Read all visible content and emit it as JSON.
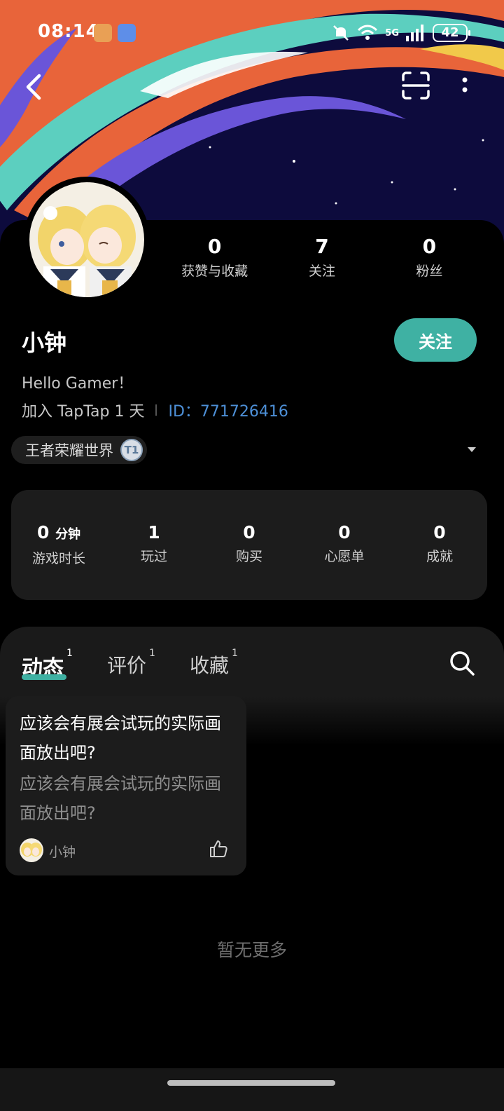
{
  "status_bar": {
    "time": "08:14",
    "network": "5G",
    "battery": "42"
  },
  "profile": {
    "name": "小钟",
    "follow_button": "关注",
    "bio": "Hello Gamer！",
    "joined": "加入 TapTap 1 天",
    "user_id": "ID：771726416",
    "stats": [
      {
        "value": "0",
        "label": "获赞与收藏"
      },
      {
        "value": "7",
        "label": "关注"
      },
      {
        "value": "0",
        "label": "粉丝"
      }
    ],
    "game_tag": "王者荣耀世界",
    "game_tag_badge": "T1"
  },
  "game_stats": {
    "playtime_value": "0",
    "playtime_unit": "分钟",
    "playtime_label": "游戏时长",
    "items": [
      {
        "value": "1",
        "label": "玩过"
      },
      {
        "value": "0",
        "label": "购买"
      },
      {
        "value": "0",
        "label": "心愿单"
      },
      {
        "value": "0",
        "label": "成就"
      }
    ]
  },
  "tabs": [
    {
      "label": "动态",
      "count": "1"
    },
    {
      "label": "评价",
      "count": "1"
    },
    {
      "label": "收藏",
      "count": "1"
    }
  ],
  "feed": {
    "post_title": "应该会有展会试玩的实际画面放出吧?",
    "post_summary": "应该会有展会试玩的实际画面放出吧?",
    "post_author": "小钟",
    "no_more": "暂无更多"
  },
  "colors": {
    "accent": "#3fb1a3",
    "id_link": "#4d8fd6",
    "background": "#000000"
  },
  "icons": [
    "back-icon",
    "scan-icon",
    "more-icon",
    "search-icon",
    "like-icon"
  ]
}
